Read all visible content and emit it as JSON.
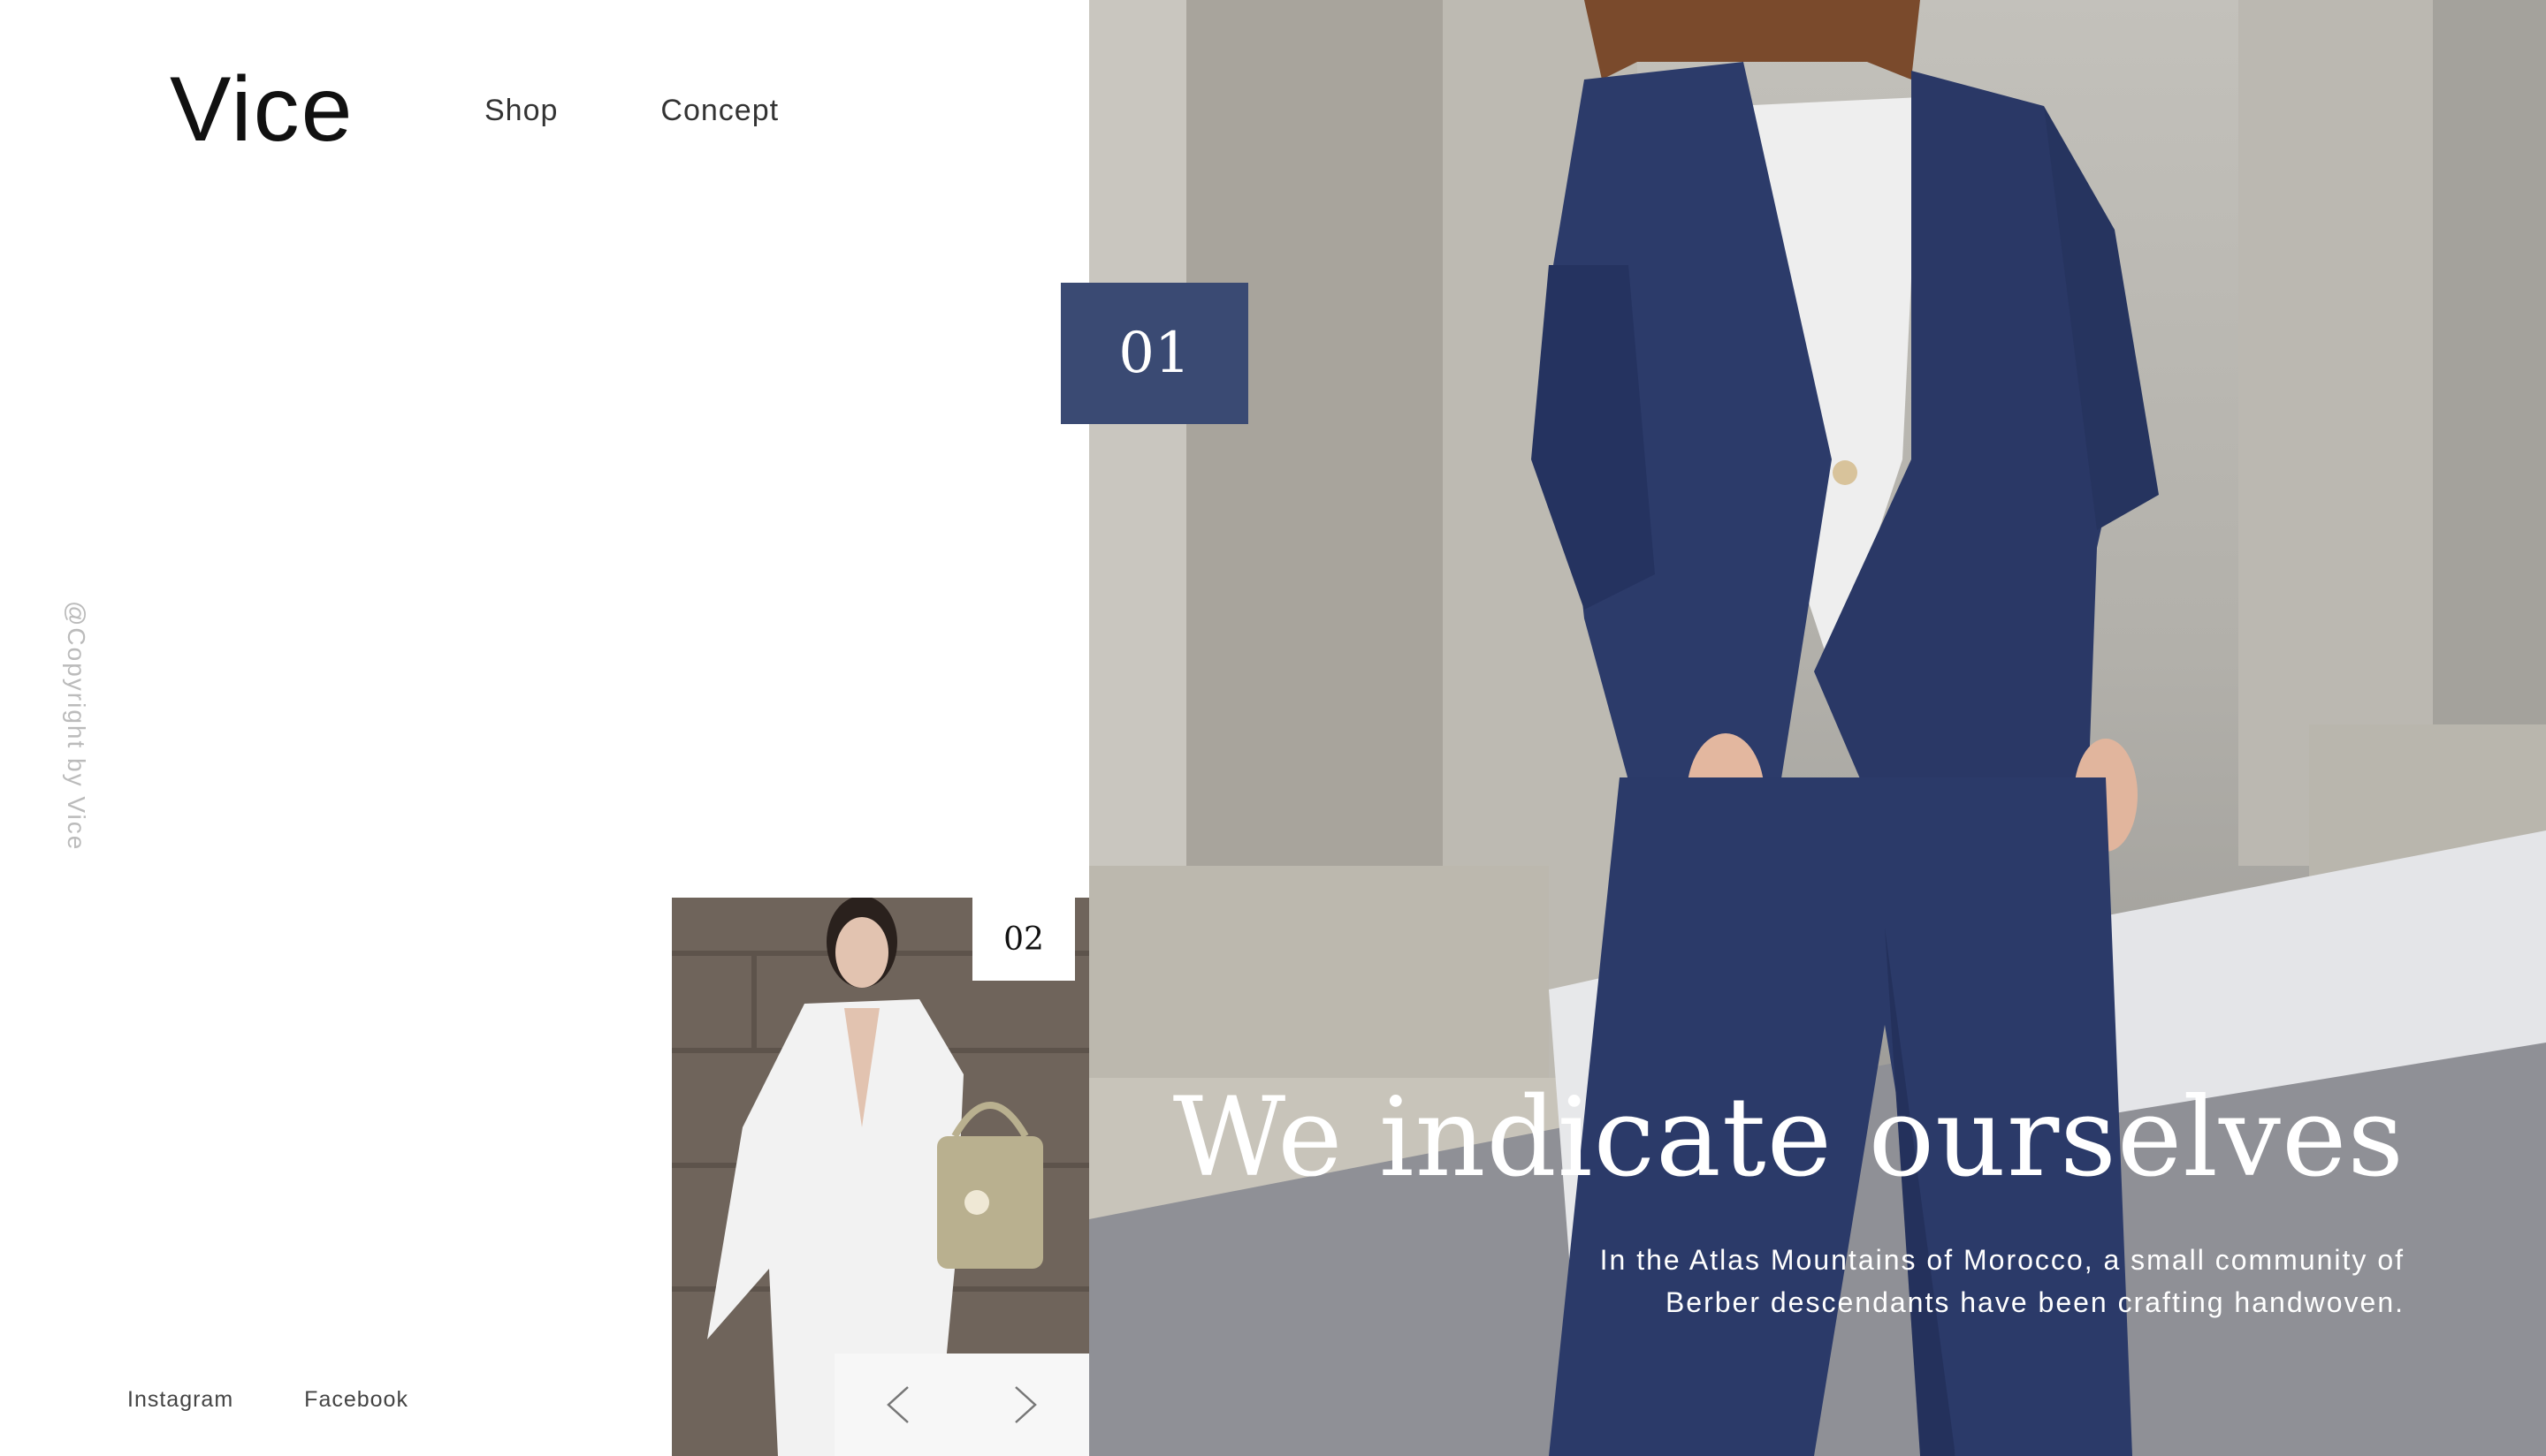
{
  "header": {
    "logo": "Vice",
    "nav": [
      "Shop",
      "Concept"
    ]
  },
  "sidebar": {
    "copyright": "@Copyright by Vice"
  },
  "footer": {
    "social": [
      "Instagram",
      "Facebook"
    ]
  },
  "slider": {
    "current_number": "01",
    "next_number": "02",
    "prev_icon": "chevron-left-icon",
    "next_icon": "chevron-right-icon"
  },
  "hero": {
    "title": "We indicate ourselves",
    "description": "In the Atlas Mountains of Morocco, a small community of Berber descendants have been crafting handwoven."
  },
  "colors": {
    "accent": "#3a4a73",
    "suit": "#2c3b6a",
    "background": "#ffffff"
  }
}
